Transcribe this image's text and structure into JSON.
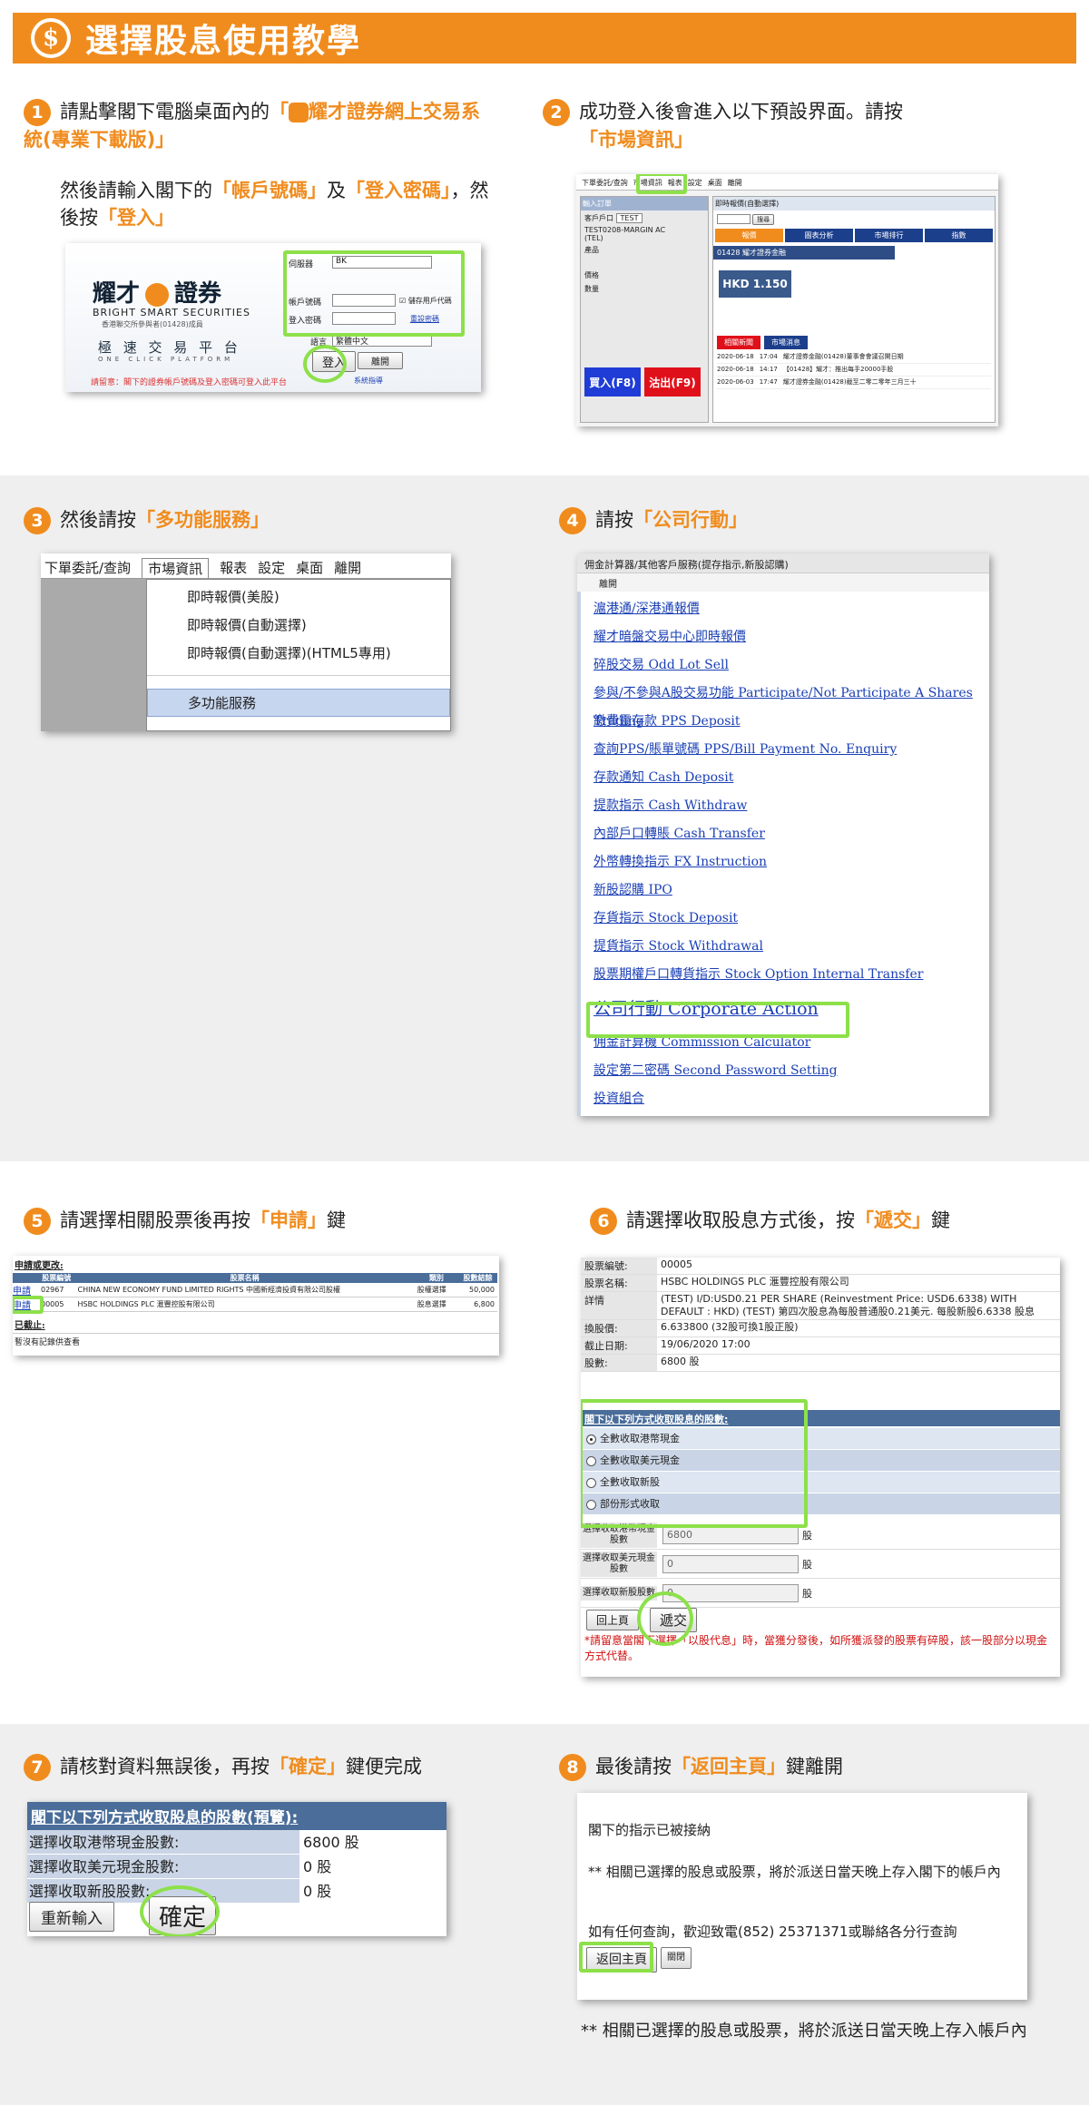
{
  "header": {
    "icon": "dollar-coin-icon",
    "coin_glyph": "$",
    "title": "選擇股息使用教學"
  },
  "colors": {
    "accent": "#f08c1e",
    "highlight": "#8de04a",
    "link": "#1a3fb5",
    "table_header": "#4a6d9a"
  },
  "step1": {
    "num": "1",
    "t1": "請點擊閣下電腦桌面內的",
    "t2": "「",
    "t3": "耀才證券網上交易系統(專業下載版)」",
    "t4": "然後請輸入閣下的",
    "t5": "「帳戶號碼」",
    "t6": "及",
    "t7": "「登入密碼」",
    "t8": "，然後按",
    "t9": "「登入」",
    "shot": {
      "brand_cn_a": "耀才",
      "brand_cn_b": "證券",
      "brand_en": "BRIGHT SMART SECURITIES",
      "brand_sub": "香港聯交所參與者(01428)成員",
      "platform_cn": "極 速 交 易 平 台",
      "platform_en": "ONE CLICK PLATFORM",
      "server_label": "伺服器",
      "server_value": "BK",
      "account_label": "帳戶號碼",
      "password_label": "登入密碼",
      "remember": "儲存用戶代碼",
      "reset": "重設密碼",
      "lang_label": "語言",
      "lang_value": "繁體中文",
      "login": "登入",
      "exit": "離開",
      "notice": "請留意：閣下的證券帳戶號碼及登入密碼可登入此平台",
      "help": "系統指導"
    }
  },
  "step2": {
    "num": "2",
    "t1": "成功登入後會進入以下預設界面。請按",
    "t2": "「市場資訊」",
    "shot": {
      "menu": [
        "下單委託/查詢",
        "市場資訊",
        "報表",
        "設定",
        "桌面",
        "離開"
      ],
      "left_title": "輸入訂單",
      "client_label": "客戶戶口",
      "client_value": "TEST",
      "account_name": "TEST0208-MARGIN AC",
      "tel": "(TEL)",
      "product": "產品",
      "price": "價格",
      "qty": "數量",
      "buy": "買入(F8)",
      "sell": "沽出(F9)",
      "right_title": "即時報價(自動選擇)",
      "search": "搜尋",
      "tabs": [
        "報價",
        "圖表分析",
        "市場排行",
        "指數"
      ],
      "stock": "01428  耀才證券金融",
      "price_box": "HKD 1.150",
      "news_tabs": [
        "相關新聞",
        "市場消息"
      ],
      "news": [
        {
          "date": "2020-06-18",
          "time": "17:04",
          "title": "耀才證券金融(01428)董事會會議召開日期"
        },
        {
          "date": "2020-06-18",
          "time": "14:17",
          "title": "【01428】耀才：推出每手20000手股"
        },
        {
          "date": "2020-06-03",
          "time": "17:47",
          "title": "耀才證券金融(01428)截至二零二零年三月三十"
        }
      ]
    }
  },
  "step3": {
    "num": "3",
    "t1": "然後請按",
    "t2": "「多功能服務」",
    "shot": {
      "menu": [
        "下單委託/查詢",
        "市場資訊",
        "報表",
        "設定",
        "桌面",
        "離開"
      ],
      "items": [
        "即時報價(美股)",
        "即時報價(自動選擇)",
        "即時報價(自動選擇)(HTML5專用)",
        "多功能服務"
      ]
    }
  },
  "step4": {
    "num": "4",
    "t1": "請按",
    "t2": "「公司行動」",
    "shot": {
      "title": "佣金計算器/其他客戶服務(提存指示,新股認購)",
      "back": "離開",
      "links": [
        "滬港通/深港通報價",
        "耀才暗盤交易中心即時報價",
        "碎股交易 Odd Lot Sell",
        "參與/不參與A股交易功能 Participate/Not Participate A Shares Trading",
        "繳費靈存款 PPS Deposit",
        "查詢PPS/賬單號碼 PPS/Bill Payment No. Enquiry",
        "存款通知 Cash Deposit",
        "提款指示 Cash Withdraw",
        "內部戶口轉賬 Cash Transfer",
        "外幣轉換指示 FX Instruction",
        "新股認購 IPO",
        "存貨指示 Stock Deposit",
        "提貨指示 Stock Withdrawal",
        "股票期權戶口轉貨指示 Stock Option Internal Transfer",
        "公司行動 Corporate Action",
        "佣金計算機 Commission Calculator",
        "設定第二密碼 Second Password Setting",
        "投資組合"
      ]
    }
  },
  "step5": {
    "num": "5",
    "t1": "請選擇相關股票後再按",
    "t2": "「申請」",
    "t3": "鍵",
    "shot": {
      "caption": "申請或更改:",
      "headers": [
        "股票編號",
        "股票名稱",
        "類別",
        "股數結餘"
      ],
      "rows": [
        {
          "action": "申請",
          "code": "02967",
          "name": "CHINA NEW ECONOMY FUND LIMITED RIGHTS 中國新經濟投資有限公司股權",
          "type": "股權選擇",
          "qty": "50,000"
        },
        {
          "action": "申請",
          "code": "00005",
          "name": "HSBC HOLDINGS PLC 滙豐控股有限公司",
          "type": "股息選擇",
          "qty": "6,800"
        }
      ],
      "done": "已截止:",
      "empty": "暫沒有記錄供查看"
    }
  },
  "step6": {
    "num": "6",
    "t1": "請選擇收取股息方式後，按",
    "t2": "「遞交」",
    "t3": "鍵",
    "shot": {
      "info": [
        {
          "k": "股票編號:",
          "v": "00005"
        },
        {
          "k": "股票名稱:",
          "v": "HSBC HOLDINGS PLC 滙豐控股有限公司"
        },
        {
          "k": "詳情",
          "v": "(TEST) I/D:USD0.21 PER SHARE (Reinvestment Price: USD6.6338) WITH DEFAULT : HKD) (TEST) 第四次股息為每股普通股0.21美元. 每股新股6.6338 股息"
        },
        {
          "k": "換股價:",
          "v": "6.633800 (32股可換1股正股)"
        },
        {
          "k": "截止日期:",
          "v": "19/06/2020 17:00"
        },
        {
          "k": "股數:",
          "v": "6800 股"
        }
      ],
      "section": "閣下以下列方式收取股息的股數:",
      "options": [
        "全數收取港幣現金",
        "全數收取美元現金",
        "全數收取新股",
        "部份形式收取"
      ],
      "fields": [
        {
          "label": "選擇收取港幣現金股數",
          "value": "6800",
          "unit": "股"
        },
        {
          "label": "選擇收取美元現金股數",
          "value": "0",
          "unit": "股"
        },
        {
          "label": "選擇收取新股股數",
          "value": "0",
          "unit": "股"
        }
      ],
      "back": "回上頁",
      "submit": "遞交",
      "note": "*請留意當閣下選擇「以股代息」時，當獲分發後，如所獲派發的股票有碎股，該一股部分以現金方式代替。"
    }
  },
  "step7": {
    "num": "7",
    "t1": "請核對資料無誤後，再按",
    "t2": "「確定」",
    "t3": "鍵便完成",
    "shot": {
      "header": "閣下以下列方式收取股息的股數(預覽):",
      "rows": [
        {
          "k": "選擇收取港幣現金股數:",
          "v": "6800 股"
        },
        {
          "k": "選擇收取美元現金股數:",
          "v": "0 股"
        },
        {
          "k": "選擇收取新股股數:",
          "v": "0 股"
        }
      ],
      "reset": "重新輸入",
      "confirm": "確定"
    }
  },
  "step8": {
    "num": "8",
    "t1": "最後請按",
    "t2": "「返回主頁」",
    "t3": "鍵離開",
    "shot": {
      "line1": "閣下的指示已被接納",
      "line2": "** 相關已選擇的股息或股票，將於派送日當天晚上存入閣下的帳戶內",
      "line3": "如有任何查詢，歡迎致電(852) 25371371或聯絡各分行查詢",
      "home": "返回主頁",
      "close": "關閉"
    },
    "footnote": "** 相關已選擇的股息或股票，將於派送日當天晚上存入帳戶內"
  }
}
